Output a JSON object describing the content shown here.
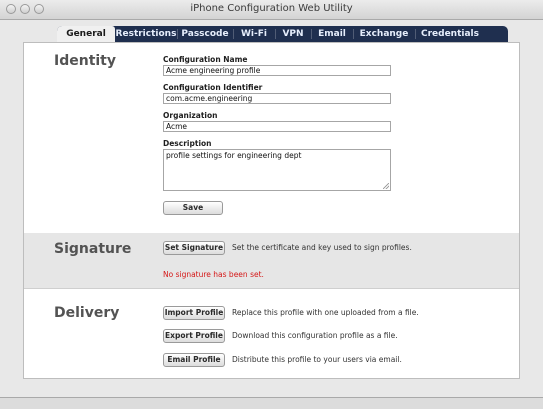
{
  "window": {
    "title": "iPhone Configuration Web Utility"
  },
  "tabs": [
    {
      "label": "General",
      "active": true
    },
    {
      "label": "Restrictions",
      "active": false
    },
    {
      "label": "Passcode",
      "active": false
    },
    {
      "label": "Wi-Fi",
      "active": false
    },
    {
      "label": "VPN",
      "active": false
    },
    {
      "label": "Email",
      "active": false
    },
    {
      "label": "Exchange",
      "active": false
    },
    {
      "label": "Credentials",
      "active": false
    }
  ],
  "identity": {
    "heading": "Identity",
    "config_name_label": "Configuration Name",
    "config_name_value": "Acme engineering profile",
    "config_id_label": "Configuration Identifier",
    "config_id_value": "com.acme.engineering",
    "org_label": "Organization",
    "org_value": "Acme",
    "desc_label": "Description",
    "desc_value": "profile settings for engineering dept",
    "save_label": "Save"
  },
  "signature": {
    "heading": "Signature",
    "button_label": "Set Signature",
    "description": "Set the certificate and key used to sign profiles.",
    "error_text": "No signature has been set."
  },
  "delivery": {
    "heading": "Delivery",
    "import_label": "Import Profile",
    "import_desc": "Replace this profile with one uploaded from a file.",
    "export_label": "Export Profile",
    "export_desc": "Download this configuration profile as a file.",
    "email_label": "Email Profile",
    "email_desc": "Distribute this profile to your users via email."
  },
  "colors": {
    "tabbar": "#1f2f4f",
    "error": "#d51818",
    "signature_band": "#e6e6e6"
  }
}
